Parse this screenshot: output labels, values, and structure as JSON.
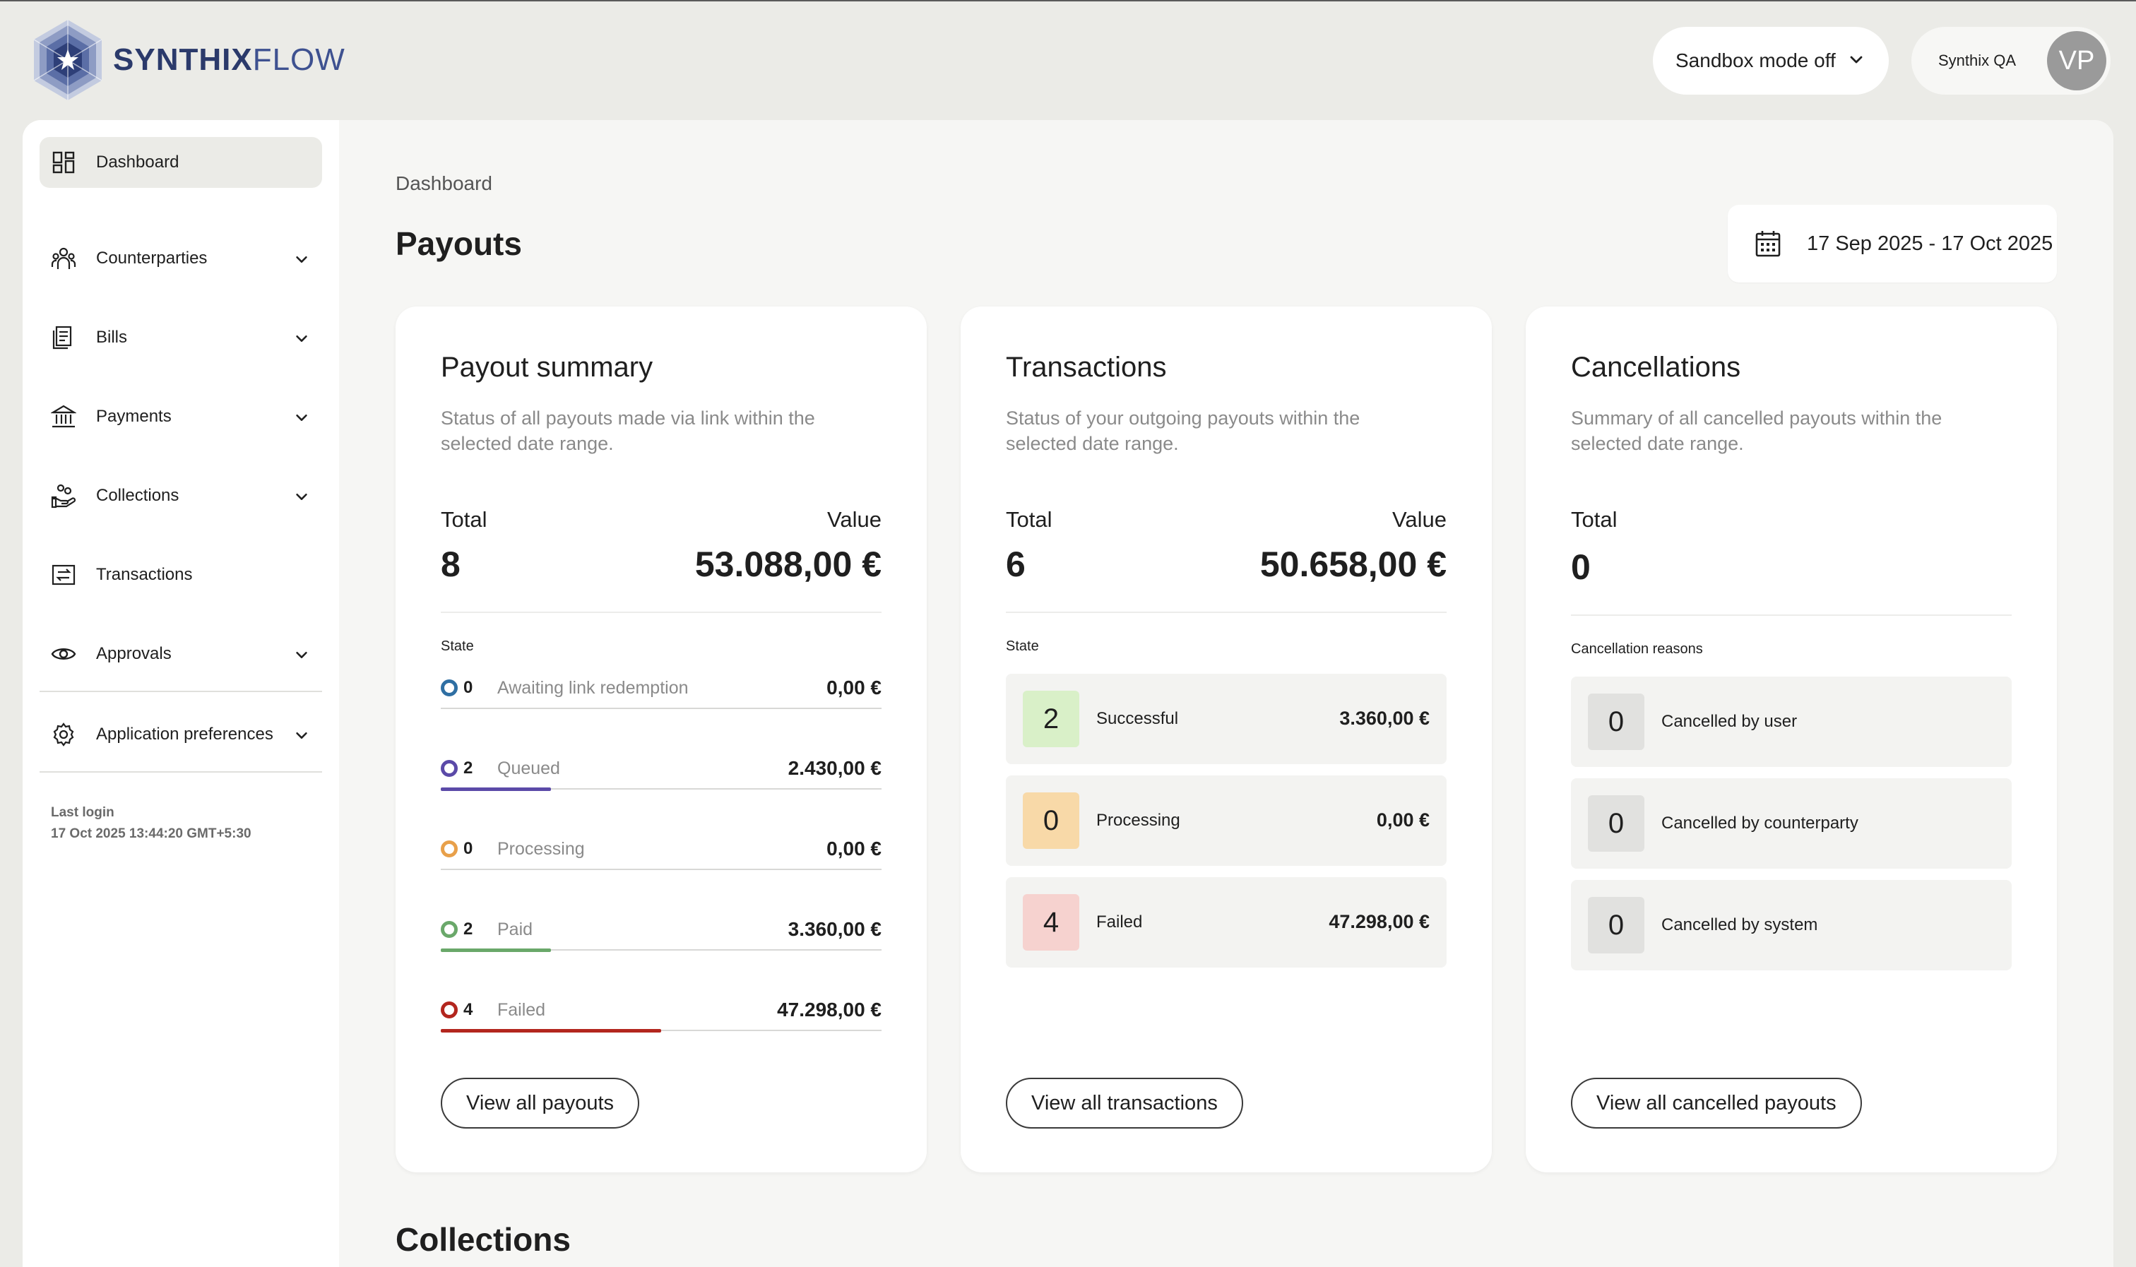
{
  "app": {
    "logo_bold": "SYNTHIX",
    "logo_light": "FLOW"
  },
  "header": {
    "sandbox_label": "Sandbox mode off",
    "org_name": "Synthix QA",
    "avatar_initials": "VP"
  },
  "sidebar": {
    "items": [
      {
        "label": "Dashboard",
        "icon": "dashboard-icon",
        "active": true
      },
      {
        "label": "Counterparties",
        "icon": "users-icon",
        "expandable": true
      },
      {
        "label": "Bills",
        "icon": "bills-icon",
        "expandable": true
      },
      {
        "label": "Payments",
        "icon": "bank-icon",
        "expandable": true
      },
      {
        "label": "Collections",
        "icon": "hand-coins-icon",
        "expandable": true
      },
      {
        "label": "Transactions",
        "icon": "transfer-icon"
      },
      {
        "label": "Approvals",
        "icon": "eye-icon",
        "expandable": true
      },
      {
        "label": "Application preferences",
        "icon": "gear-icon",
        "expandable": true
      }
    ],
    "last_login_label": "Last login",
    "last_login_value": "17 Oct 2025 13:44:20 GMT+5:30"
  },
  "main": {
    "breadcrumb": "Dashboard",
    "title": "Payouts",
    "date_range": "17 Sep 2025 - 17 Oct 2025",
    "next_section_title": "Collections"
  },
  "payout_summary": {
    "title": "Payout summary",
    "description": "Status of all payouts made via link within the selected date range.",
    "total_label": "Total",
    "value_label": "Value",
    "total": "8",
    "value": "53.088,00 €",
    "state_label": "State",
    "rows": [
      {
        "count": "0",
        "label": "Awaiting link redemption",
        "amount": "0,00 €",
        "color": "#2f6fa3",
        "share": 0
      },
      {
        "count": "2",
        "label": "Queued",
        "amount": "2.430,00 €",
        "color": "#5b4aa8",
        "share": 0.25
      },
      {
        "count": "0",
        "label": "Processing",
        "amount": "0,00 €",
        "color": "#e8a04a",
        "share": 0
      },
      {
        "count": "2",
        "label": "Paid",
        "amount": "3.360,00 €",
        "color": "#6aa86a",
        "share": 0.25
      },
      {
        "count": "4",
        "label": "Failed",
        "amount": "47.298,00 €",
        "color": "#b3261e",
        "share": 0.5
      }
    ],
    "button": "View all payouts"
  },
  "transactions": {
    "title": "Transactions",
    "description": "Status of your outgoing payouts within the selected date range.",
    "total_label": "Total",
    "value_label": "Value",
    "total": "6",
    "value": "50.658,00 €",
    "state_label": "State",
    "rows": [
      {
        "count": "2",
        "label": "Successful",
        "amount": "3.360,00 €",
        "badge_color": "#d9f0c8"
      },
      {
        "count": "0",
        "label": "Processing",
        "amount": "0,00 €",
        "badge_color": "#f8d9a8"
      },
      {
        "count": "4",
        "label": "Failed",
        "amount": "47.298,00 €",
        "badge_color": "#f6d2cf"
      }
    ],
    "button": "View all transactions"
  },
  "cancellations": {
    "title": "Cancellations",
    "description": "Summary of all cancelled payouts within the selected date range.",
    "total_label": "Total",
    "total": "0",
    "reasons_label": "Cancellation reasons",
    "rows": [
      {
        "count": "0",
        "label": "Cancelled by user",
        "badge_color": "#e1e1df"
      },
      {
        "count": "0",
        "label": "Cancelled by counterparty",
        "badge_color": "#e1e1df"
      },
      {
        "count": "0",
        "label": "Cancelled by system",
        "badge_color": "#e1e1df"
      }
    ],
    "button": "View all cancelled payouts"
  }
}
